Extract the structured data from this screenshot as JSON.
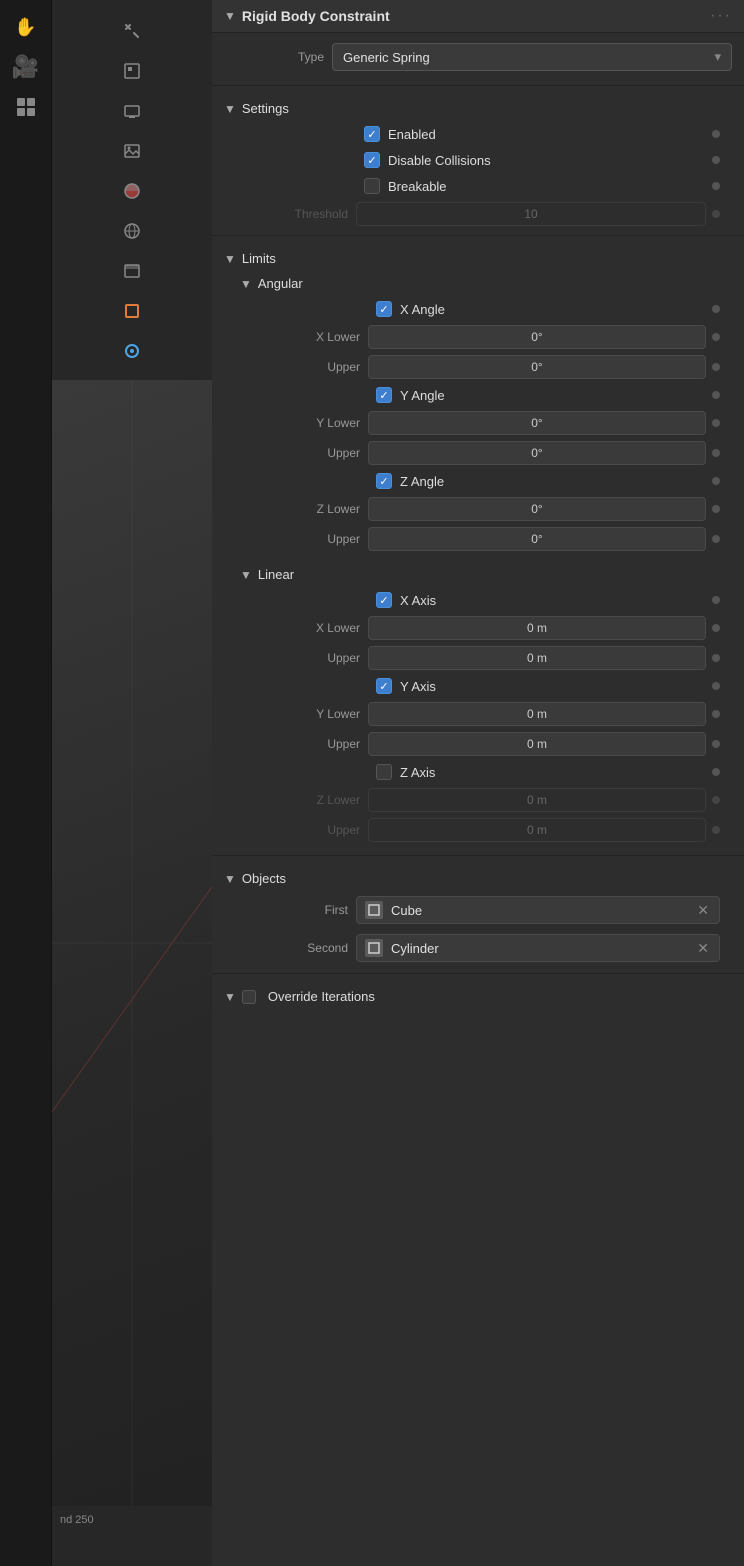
{
  "app": {
    "title": "Rigid Body Constraint"
  },
  "sidebar": {
    "icons": [
      {
        "name": "hand-tool-icon",
        "symbol": "✋",
        "active": false
      },
      {
        "name": "camera-icon",
        "symbol": "🎥",
        "active": false
      },
      {
        "name": "grid-icon",
        "symbol": "⊞",
        "active": false
      }
    ],
    "icons2": [
      {
        "name": "tools-icon",
        "symbol": "🔧",
        "active": false
      },
      {
        "name": "scene-icon",
        "symbol": "🎬",
        "active": false
      },
      {
        "name": "render-icon",
        "symbol": "🖼",
        "active": false
      },
      {
        "name": "image-icon",
        "symbol": "🏞",
        "active": false
      },
      {
        "name": "compositor-icon",
        "symbol": "◑",
        "active": false
      },
      {
        "name": "globe-icon",
        "symbol": "🌐",
        "active": false
      },
      {
        "name": "archive-icon",
        "symbol": "⊟",
        "active": false
      },
      {
        "name": "object-icon",
        "symbol": "□",
        "active": true,
        "color": "orange"
      },
      {
        "name": "constraint-icon",
        "symbol": "◎",
        "active": true,
        "color": "blue"
      },
      {
        "name": "physics-icon",
        "symbol": "◯",
        "active": false
      },
      {
        "name": "transform-icon",
        "symbol": "┤",
        "active": false
      },
      {
        "name": "checker-icon",
        "symbol": "⛶",
        "active": false
      }
    ],
    "bottom_text": "nd  250"
  },
  "panel": {
    "title": "Rigid Body Constraint",
    "dots_menu": "···",
    "type_label": "Type",
    "type_value": "Generic Spring",
    "sections": {
      "settings": {
        "label": "Settings",
        "enabled_label": "Enabled",
        "enabled_checked": true,
        "disable_collisions_label": "Disable Collisions",
        "disable_collisions_checked": true,
        "breakable_label": "Breakable",
        "breakable_checked": false,
        "threshold_label": "Threshold",
        "threshold_value": "10",
        "threshold_disabled": true
      },
      "limits": {
        "label": "Limits"
      },
      "angular": {
        "label": "Angular",
        "x_angle_label": "X Angle",
        "x_angle_checked": true,
        "x_lower_label": "X Lower",
        "x_lower_value": "0°",
        "x_upper_label": "Upper",
        "x_upper_value": "0°",
        "y_angle_label": "Y Angle",
        "y_angle_checked": true,
        "y_lower_label": "Y Lower",
        "y_lower_value": "0°",
        "y_upper_label": "Upper",
        "y_upper_value": "0°",
        "z_angle_label": "Z Angle",
        "z_angle_checked": true,
        "z_lower_label": "Z Lower",
        "z_lower_value": "0°",
        "z_upper_label": "Upper",
        "z_upper_value": "0°"
      },
      "linear": {
        "label": "Linear",
        "x_axis_label": "X Axis",
        "x_axis_checked": true,
        "x_lower_label": "X Lower",
        "x_lower_value": "0 m",
        "x_upper_label": "Upper",
        "x_upper_value": "0 m",
        "y_axis_label": "Y Axis",
        "y_axis_checked": true,
        "y_lower_label": "Y Lower",
        "y_lower_value": "0 m",
        "y_upper_label": "Upper",
        "y_upper_value": "0 m",
        "z_axis_label": "Z Axis",
        "z_axis_checked": false,
        "z_lower_label": "Z Lower",
        "z_lower_value": "0 m",
        "z_upper_label": "Upper",
        "z_upper_value": "0 m",
        "z_disabled": true
      },
      "objects": {
        "label": "Objects",
        "first_label": "First",
        "first_value": "Cube",
        "second_label": "Second",
        "second_value": "Cylinder"
      },
      "override": {
        "label": "Override Iterations",
        "checked": false
      }
    }
  }
}
